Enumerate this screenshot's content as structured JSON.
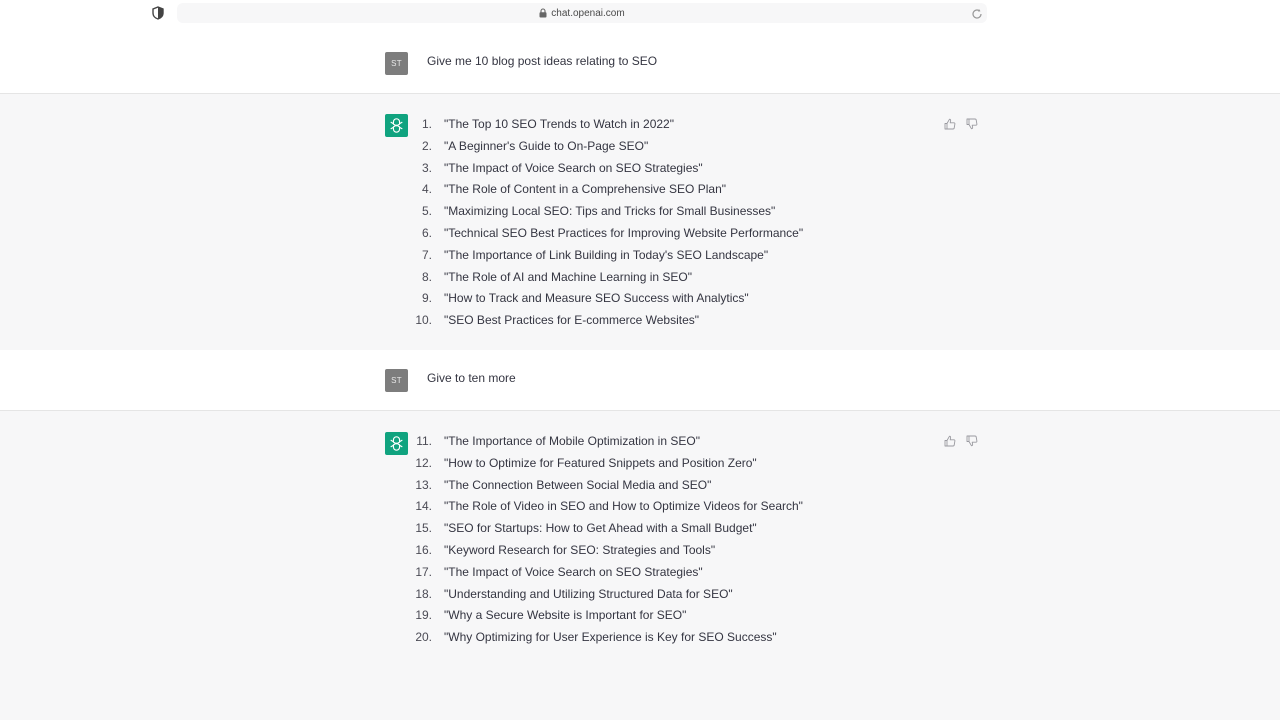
{
  "browser": {
    "url": "chat.openai.com"
  },
  "conversation": {
    "messages": [
      {
        "role": "user",
        "avatar": "ST",
        "text": "Give me 10 blog post ideas relating to SEO"
      },
      {
        "role": "assistant",
        "items": [
          {
            "num": "1.",
            "text": "\"The Top 10 SEO Trends to Watch in 2022\""
          },
          {
            "num": "2.",
            "text": "\"A Beginner's Guide to On-Page SEO\""
          },
          {
            "num": "3.",
            "text": "\"The Impact of Voice Search on SEO Strategies\""
          },
          {
            "num": "4.",
            "text": "\"The Role of Content in a Comprehensive SEO Plan\""
          },
          {
            "num": "5.",
            "text": "\"Maximizing Local SEO: Tips and Tricks for Small Businesses\""
          },
          {
            "num": "6.",
            "text": "\"Technical SEO Best Practices for Improving Website Performance\""
          },
          {
            "num": "7.",
            "text": "\"The Importance of Link Building in Today's SEO Landscape\""
          },
          {
            "num": "8.",
            "text": "\"The Role of AI and Machine Learning in SEO\""
          },
          {
            "num": "9.",
            "text": "\"How to Track and Measure SEO Success with Analytics\""
          },
          {
            "num": "10.",
            "text": "\"SEO Best Practices for E-commerce Websites\""
          }
        ]
      },
      {
        "role": "user",
        "avatar": "ST",
        "text": "Give to ten more"
      },
      {
        "role": "assistant",
        "items": [
          {
            "num": "11.",
            "text": "\"The Importance of Mobile Optimization in SEO\""
          },
          {
            "num": "12.",
            "text": "\"How to Optimize for Featured Snippets and Position Zero\""
          },
          {
            "num": "13.",
            "text": "\"The Connection Between Social Media and SEO\""
          },
          {
            "num": "14.",
            "text": "\"The Role of Video in SEO and How to Optimize Videos for Search\""
          },
          {
            "num": "15.",
            "text": "\"SEO for Startups: How to Get Ahead with a Small Budget\""
          },
          {
            "num": "16.",
            "text": "\"Keyword Research for SEO: Strategies and Tools\""
          },
          {
            "num": "17.",
            "text": "\"The Impact of Voice Search on SEO Strategies\""
          },
          {
            "num": "18.",
            "text": "\"Understanding and Utilizing Structured Data for SEO\""
          },
          {
            "num": "19.",
            "text": "\"Why a Secure Website is Important for SEO\""
          },
          {
            "num": "20.",
            "text": "\"Why Optimizing for User Experience is Key for SEO Success\""
          }
        ]
      }
    ]
  },
  "icons": {
    "shield": "shield-icon",
    "lock": "lock-icon",
    "reload": "reload-icon",
    "bot_avatar": "openai-logo-icon",
    "thumbs_up": "thumbs-up-icon",
    "thumbs_down": "thumbs-down-icon"
  },
  "colors": {
    "assistant_bg": "#f7f7f8",
    "bot_avatar": "#10a37f",
    "user_avatar": "#7d7d7d",
    "text": "#343541"
  }
}
